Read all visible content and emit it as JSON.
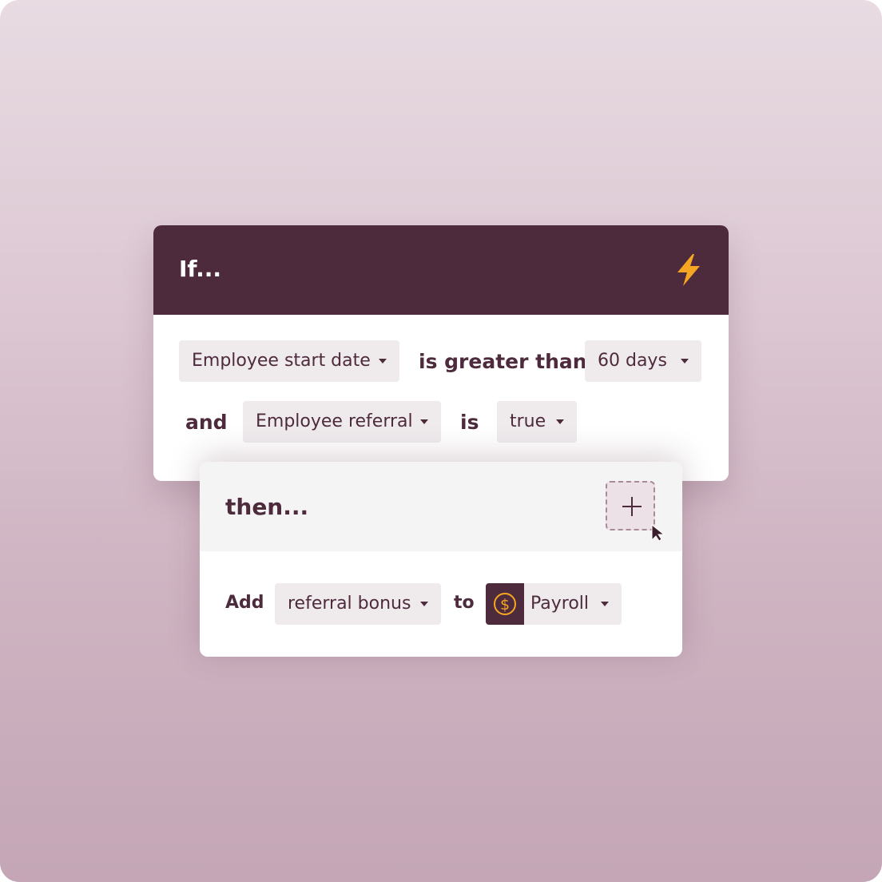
{
  "if_card": {
    "title": "If...",
    "icon": "lightning-bolt-icon",
    "row1": {
      "field": "Employee start date",
      "operator": "is greater than",
      "value": "60 days"
    },
    "row2": {
      "connector": "and",
      "field": "Employee referral",
      "operator": "is",
      "value": "true"
    }
  },
  "then_card": {
    "title": "then...",
    "add_icon": "plus-icon",
    "action": {
      "verb": "Add",
      "item": "referral bonus",
      "preposition": "to",
      "target": "Payroll",
      "target_icon": "dollar-coin-icon"
    }
  },
  "colors": {
    "header_dark": "#4e2b3c",
    "accent_bolt": "#f5a623",
    "dropdown_bg": "#efebed",
    "then_header_bg": "#f4f4f4"
  }
}
